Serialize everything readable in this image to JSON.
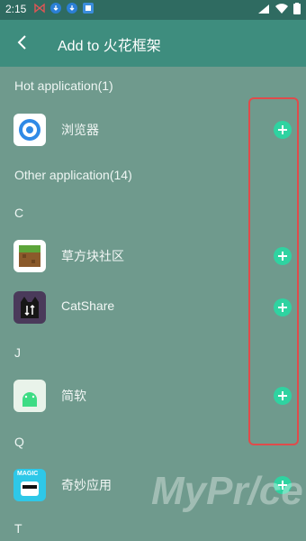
{
  "status_bar": {
    "time": "2:15"
  },
  "app_bar": {
    "title": "Add to 火花框架"
  },
  "sections": {
    "hot": "Hot application(1)",
    "other": "Other application(14)"
  },
  "letters": {
    "c": "C",
    "j": "J",
    "q": "Q",
    "t": "T"
  },
  "apps": [
    {
      "name": "浏览器"
    },
    {
      "name": "草方块社区"
    },
    {
      "name": "CatShare"
    },
    {
      "name": "简软"
    },
    {
      "name": "奇妙应用"
    }
  ],
  "icons": {
    "browser": "browser-icon",
    "grass_block": "grass-block-icon",
    "cat": "cat-icon",
    "android": "android-icon",
    "magic": "magic-app-icon",
    "add": "plus-circle-icon",
    "back": "back-arrow-icon"
  },
  "watermark": "MyPr/ce",
  "colors": {
    "background": "#6f9a8d",
    "app_bar": "#3e8d7e",
    "status_bar": "#2f6b61",
    "add_button": "#2fd3a1",
    "highlight": "#e04b4b"
  },
  "magic_label": "MAGIC"
}
